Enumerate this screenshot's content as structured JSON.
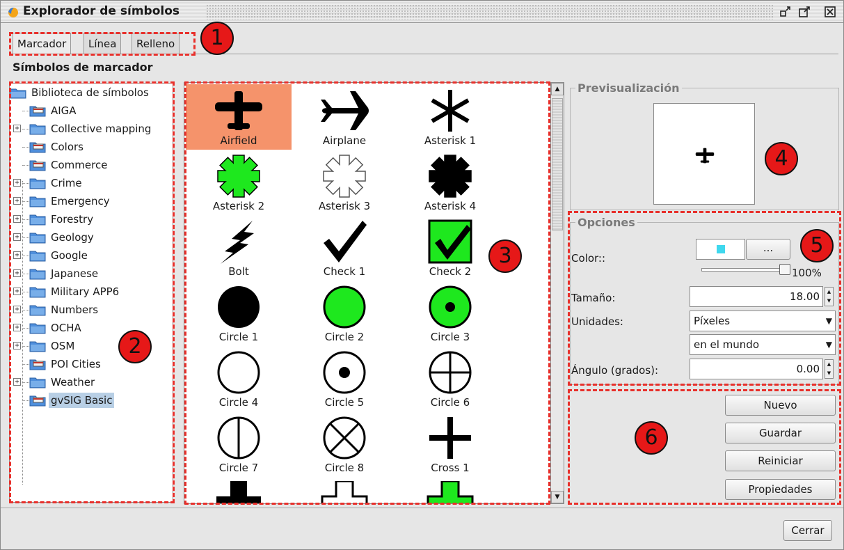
{
  "window": {
    "title": "Explorador de símbolos",
    "controls": [
      "minimize-icon",
      "maximize-icon",
      "close-icon"
    ]
  },
  "tabs": [
    {
      "label": "Marcador",
      "active": true
    },
    {
      "label": "Línea",
      "active": false
    },
    {
      "label": "Relleno",
      "active": false
    }
  ],
  "section_title": "Símbolos de marcador",
  "markers": [
    "1",
    "2",
    "3",
    "4",
    "5",
    "6"
  ],
  "tree": {
    "root": "Biblioteca de símbolos",
    "items": [
      {
        "label": "AIGA",
        "expandable": false,
        "icon": "library-icon"
      },
      {
        "label": "Collective mapping",
        "expandable": true,
        "icon": "folder-icon"
      },
      {
        "label": "Colors",
        "expandable": false,
        "icon": "library-icon"
      },
      {
        "label": "Commerce",
        "expandable": false,
        "icon": "library-icon"
      },
      {
        "label": "Crime",
        "expandable": true,
        "icon": "folder-icon"
      },
      {
        "label": "Emergency",
        "expandable": true,
        "icon": "folder-icon"
      },
      {
        "label": "Forestry",
        "expandable": true,
        "icon": "folder-icon"
      },
      {
        "label": "Geology",
        "expandable": true,
        "icon": "folder-icon"
      },
      {
        "label": "Google",
        "expandable": true,
        "icon": "folder-icon"
      },
      {
        "label": "Japanese",
        "expandable": true,
        "icon": "folder-icon"
      },
      {
        "label": "Military APP6",
        "expandable": true,
        "icon": "folder-icon"
      },
      {
        "label": "Numbers",
        "expandable": true,
        "icon": "folder-icon"
      },
      {
        "label": "OCHA",
        "expandable": true,
        "icon": "folder-icon"
      },
      {
        "label": "OSM",
        "expandable": true,
        "icon": "folder-icon"
      },
      {
        "label": "POI Cities",
        "expandable": false,
        "icon": "library-icon"
      },
      {
        "label": "Weather",
        "expandable": true,
        "icon": "folder-icon"
      },
      {
        "label": "gvSIG Basic",
        "expandable": false,
        "icon": "library-icon",
        "selected": true
      }
    ]
  },
  "symbols": [
    {
      "label": "Airfield",
      "icon": "airfield-icon",
      "selected": true
    },
    {
      "label": "Airplane",
      "icon": "airplane-icon"
    },
    {
      "label": "Asterisk 1",
      "icon": "asterisk-1-icon"
    },
    {
      "label": "Asterisk 2",
      "icon": "asterisk-2-icon"
    },
    {
      "label": "Asterisk 3",
      "icon": "asterisk-3-icon"
    },
    {
      "label": "Asterisk 4",
      "icon": "asterisk-4-icon"
    },
    {
      "label": "Bolt",
      "icon": "bolt-icon"
    },
    {
      "label": "Check 1",
      "icon": "check-1-icon"
    },
    {
      "label": "Check 2",
      "icon": "check-2-icon"
    },
    {
      "label": "Circle 1",
      "icon": "circle-1-icon"
    },
    {
      "label": "Circle 2",
      "icon": "circle-2-icon"
    },
    {
      "label": "Circle 3",
      "icon": "circle-3-icon"
    },
    {
      "label": "Circle 4",
      "icon": "circle-4-icon"
    },
    {
      "label": "Circle 5",
      "icon": "circle-5-icon"
    },
    {
      "label": "Circle 6",
      "icon": "circle-6-icon"
    },
    {
      "label": "Circle 7",
      "icon": "circle-7-icon"
    },
    {
      "label": "Circle 8",
      "icon": "circle-8-icon"
    },
    {
      "label": "Cross 1",
      "icon": "cross-1-icon"
    }
  ],
  "colors": {
    "selection": "#f5936b",
    "green": "#1ee81e",
    "swatch": "#3fd8ee",
    "annotation": "#e61818",
    "dashed": "#e8302b"
  },
  "preview": {
    "legend": "Previsualización",
    "icon": "airfield-icon"
  },
  "options": {
    "legend": "Opciones",
    "color_label": "Color::",
    "color_button": "...",
    "opacity": "100%",
    "opacity_value": 1.0,
    "size_label": "Tamaño:",
    "size_value": "18.00",
    "units_label": "Unidades:",
    "units_value": "Píxeles",
    "units_scope": "en el mundo",
    "angle_label": "Ángulo (grados):",
    "angle_value": "0.00"
  },
  "actions": {
    "new": "Nuevo",
    "save": "Guardar",
    "reset": "Reiniciar",
    "properties": "Propiedades"
  },
  "close_button": "Cerrar"
}
